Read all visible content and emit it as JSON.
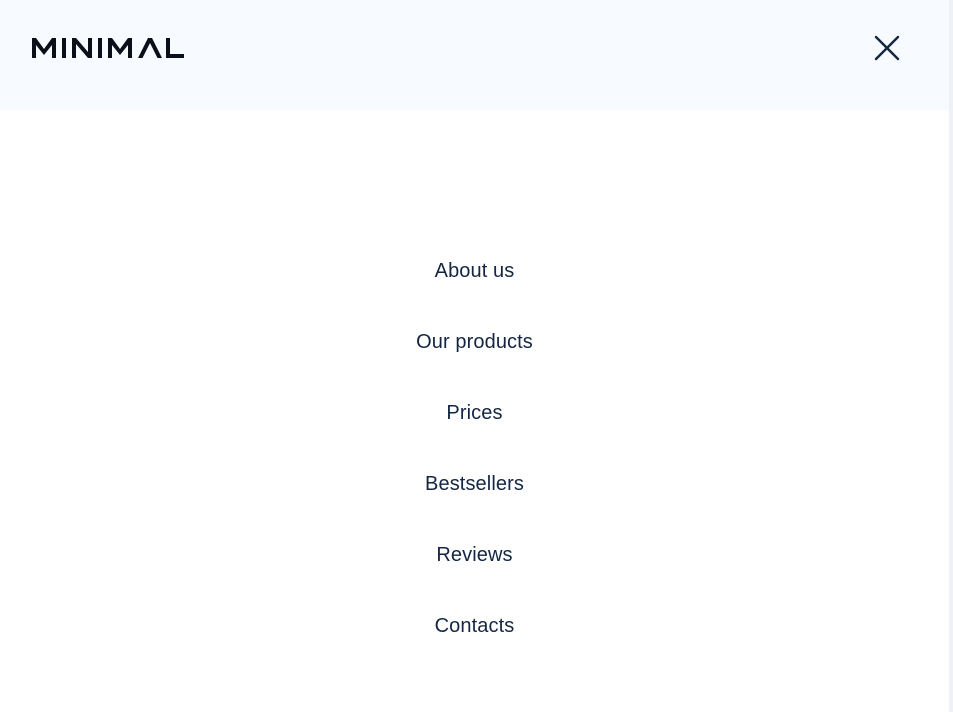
{
  "header": {
    "logo_text": "MINIMAL",
    "close_icon": "close-icon"
  },
  "nav": {
    "items": [
      {
        "label": "About us"
      },
      {
        "label": "Our products"
      },
      {
        "label": "Prices"
      },
      {
        "label": "Bestsellers"
      },
      {
        "label": "Reviews"
      },
      {
        "label": "Contacts"
      }
    ]
  },
  "colors": {
    "header_background": "#f7fafe",
    "text": "#142641",
    "logo": "#0b0f1a"
  }
}
